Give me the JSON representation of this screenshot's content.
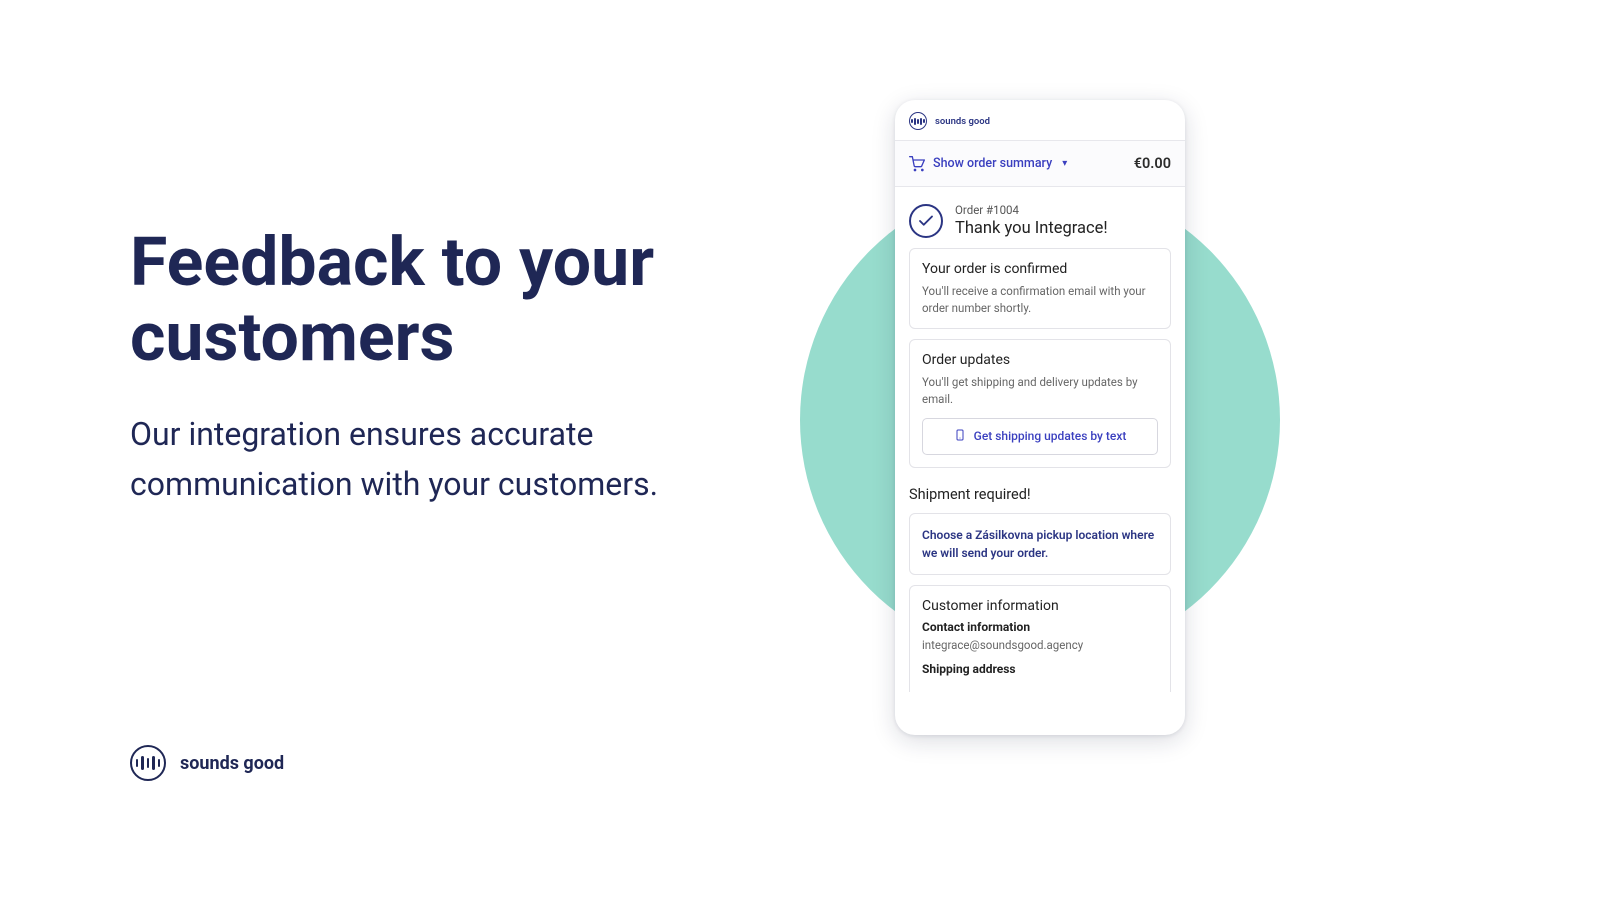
{
  "headline": "Feedback to your customers",
  "subhead": "Our integration ensures accurate communication with your customers.",
  "footer_brand": "sounds good",
  "phone": {
    "brand": "sounds good",
    "summary": {
      "toggle_label": "Show order summary",
      "total": "€0.00"
    },
    "order_line": "Order #1004",
    "thank_you": "Thank you Integrace!",
    "confirmed": {
      "title": "Your order is confirmed",
      "body": "You'll receive a confirmation email with your order number shortly."
    },
    "updates": {
      "title": "Order updates",
      "body": "You'll get shipping and delivery updates by email.",
      "button": "Get shipping updates by text"
    },
    "shipment_required": "Shipment required!",
    "pickup_instruction": "Choose a Zásilkovna pickup location where we will send your order.",
    "customer": {
      "title": "Customer information",
      "contact_label": "Contact information",
      "contact_value": "integrace@soundsgood.agency",
      "shipping_label": "Shipping address"
    }
  }
}
